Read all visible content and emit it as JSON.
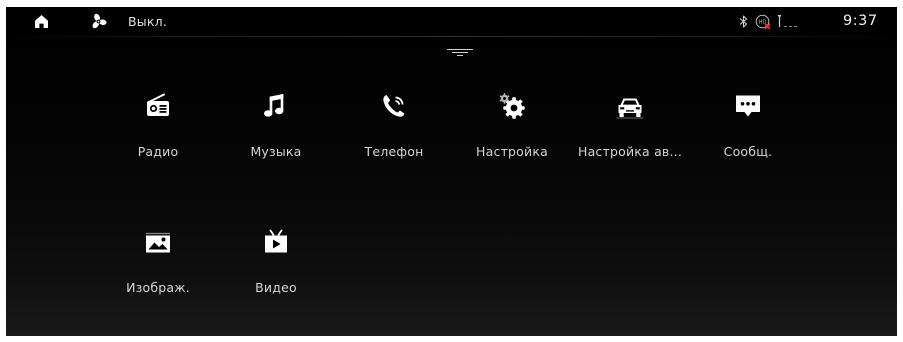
{
  "status_bar": {
    "home_icon": "home-icon",
    "fan_icon": "fan-icon",
    "fan_status": "Выкл.",
    "bluetooth_icon": "bluetooth-icon",
    "voice_icon": "voice-off-icon",
    "signal_icon": "no-signal-icon",
    "time": "9:37"
  },
  "pulldown_icon": "pulldown-handle-icon",
  "apps": [
    {
      "id": "radio",
      "label": "Радио",
      "icon": "radio-icon"
    },
    {
      "id": "music",
      "label": "Музыка",
      "icon": "music-note-icon"
    },
    {
      "id": "phone",
      "label": "Телефон",
      "icon": "phone-icon"
    },
    {
      "id": "setup",
      "label": "Настройка",
      "icon": "gear-icon"
    },
    {
      "id": "car",
      "label": "Настройка ав...",
      "icon": "car-icon"
    },
    {
      "id": "msg",
      "label": "Сообщ.",
      "icon": "message-icon"
    },
    {
      "id": "gallery",
      "label": "Изображ.",
      "icon": "image-icon"
    },
    {
      "id": "video",
      "label": "Видео",
      "icon": "video-icon"
    }
  ],
  "colors": {
    "background": "#000000",
    "text": "#d6d6d6",
    "icon": "#ffffff",
    "voice_off_badge": "#e0332f"
  }
}
